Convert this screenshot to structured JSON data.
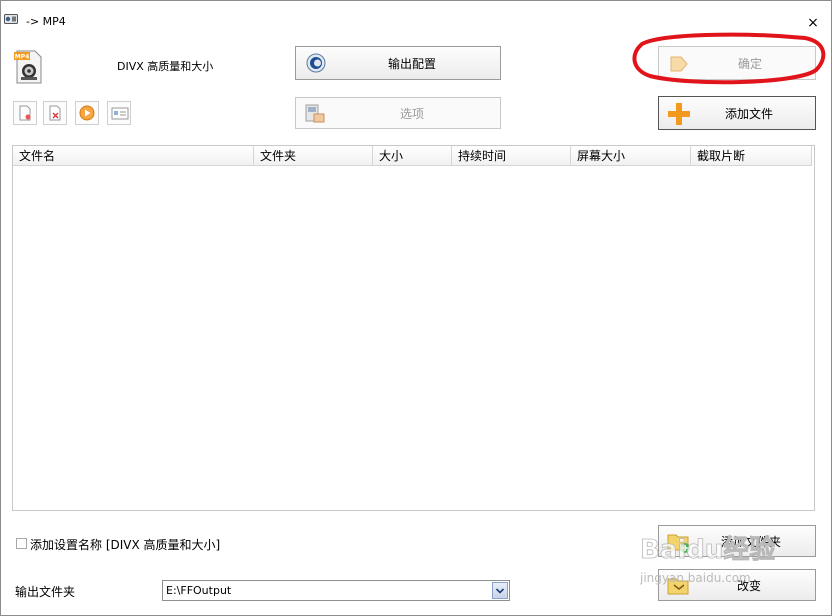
{
  "window": {
    "title": "-> MP4",
    "close_glyph": "×"
  },
  "preset": {
    "label": "DIVX 高质量和大小",
    "format_badge": "MP4"
  },
  "buttons": {
    "output_config": "输出配置",
    "options": "选项",
    "ok": "确定",
    "add_file": "添加文件",
    "add_folder": "添加文件夹",
    "change": "改变"
  },
  "toolbar_icons": [
    "new-file-icon",
    "delete-icon",
    "play-icon",
    "info-icon"
  ],
  "file_table": {
    "columns": [
      "文件名",
      "文件夹",
      "大小",
      "持续时间",
      "屏幕大小",
      "截取片断"
    ],
    "rows": []
  },
  "settings_name": {
    "label": "添加设置名称 [DIVX 高质量和大小]",
    "checked": false
  },
  "output_folder": {
    "label": "输出文件夹",
    "value": "E:\\FFOutput"
  },
  "watermark": {
    "text": "Baidu经验",
    "sub": "jingyan.baidu.com"
  },
  "colors": {
    "annotation": "#e0141a",
    "accent_orange": "#f39a1e"
  }
}
